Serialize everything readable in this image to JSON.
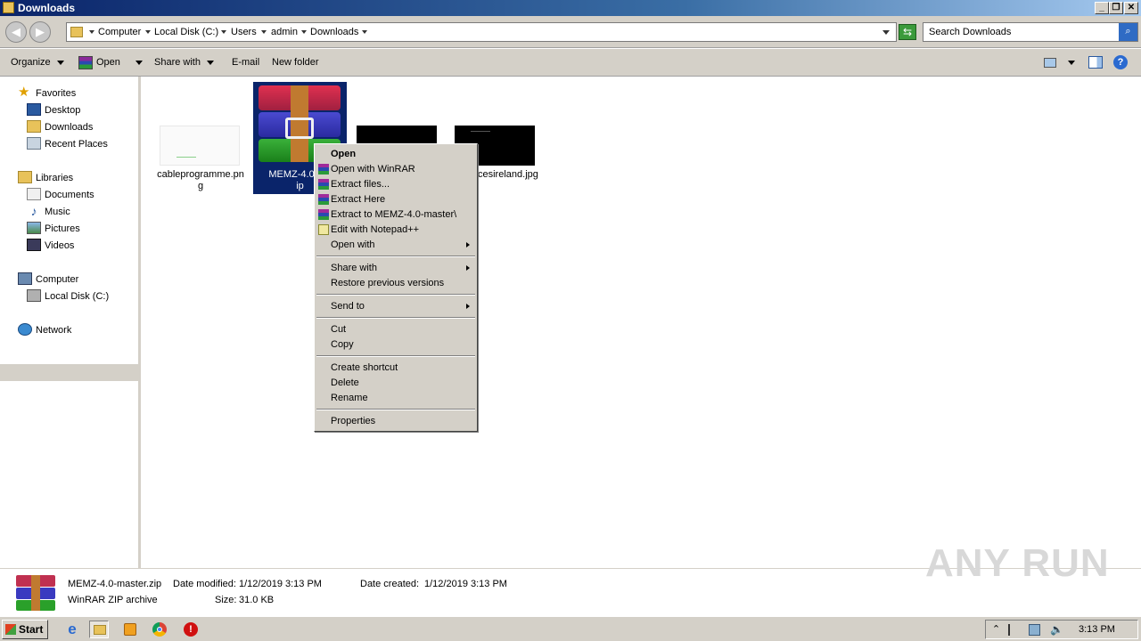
{
  "window": {
    "title": "Downloads",
    "controls": [
      "_",
      "❐",
      "✕"
    ]
  },
  "address": {
    "crumbs": [
      "Computer",
      "Local Disk (C:)",
      "Users",
      "admin",
      "Downloads"
    ]
  },
  "search": {
    "placeholder": "Search Downloads"
  },
  "toolbar": {
    "organize": "Organize",
    "open": "Open",
    "share_with": "Share with",
    "email": "E-mail",
    "new_folder": "New folder"
  },
  "nav": {
    "favorites": "Favorites",
    "desktop": "Desktop",
    "downloads": "Downloads",
    "recent_places": "Recent Places",
    "libraries": "Libraries",
    "documents": "Documents",
    "music": "Music",
    "pictures": "Pictures",
    "videos": "Videos",
    "computer": "Computer",
    "local_disk": "Local Disk (C:)",
    "network": "Network"
  },
  "files": {
    "f1": {
      "line1": "cableprogramme.pn",
      "line2": "g"
    },
    "f2": {
      "line1": "MEMZ-4.0-ma",
      "line2": "ip"
    },
    "f4": {
      "line1": "cesireland.jpg"
    }
  },
  "context_menu": {
    "open": "Open",
    "open_with_winrar": "Open with WinRAR",
    "extract_files": "Extract files...",
    "extract_here": "Extract Here",
    "extract_to": "Extract to MEMZ-4.0-master\\",
    "edit_notepad": "Edit with Notepad++",
    "open_with": "Open with",
    "share_with": "Share with",
    "restore_previous": "Restore previous versions",
    "send_to": "Send to",
    "cut": "Cut",
    "copy": "Copy",
    "create_shortcut": "Create shortcut",
    "delete": "Delete",
    "rename": "Rename",
    "properties": "Properties"
  },
  "details": {
    "filename": "MEMZ-4.0-master.zip",
    "type": "WinRAR ZIP archive",
    "date_modified_label": "Date modified:",
    "date_modified": "1/12/2019 3:13 PM",
    "size_label": "Size:",
    "size": "31.0 KB",
    "date_created_label": "Date created:",
    "date_created": "1/12/2019 3:13 PM"
  },
  "watermark": "ANY RUN",
  "taskbar": {
    "start": "Start",
    "clock": "3:13 PM",
    "tray_expand": "⌃"
  },
  "colors": {
    "selection": "#0a246a",
    "face": "#d4d0c8"
  }
}
